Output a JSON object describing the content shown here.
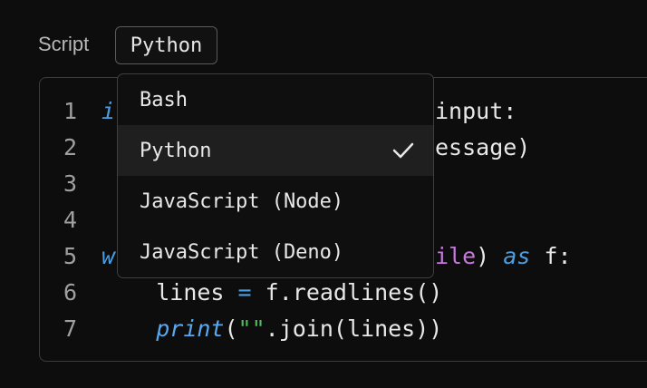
{
  "script_label": "Script",
  "language_select": {
    "value": "Python"
  },
  "dropdown": {
    "options": [
      {
        "label": "Bash",
        "selected": false
      },
      {
        "label": "Python",
        "selected": true
      },
      {
        "label": "JavaScript (Node)",
        "selected": false
      },
      {
        "label": "JavaScript (Deno)",
        "selected": false
      }
    ],
    "check_icon": "checkmark-icon"
  },
  "editor": {
    "line_numbers": [
      "1",
      "2",
      "3",
      "4",
      "5",
      "6",
      "7"
    ],
    "lines": {
      "l1": {
        "kw": "i",
        "tail": "input:"
      },
      "l2": {
        "tail": "essage)"
      },
      "l5": {
        "kw": "w",
        "pu": "ile",
        "paren": ")",
        "as": "as",
        "tail": " f:"
      },
      "l6": {
        "indent": "    ",
        "var": "lines",
        "op": "=",
        "tail": " f.readlines()"
      },
      "l7": {
        "indent": "    ",
        "fn": "print",
        "open": "(",
        "str": "\"\"",
        "tail": ".join(lines))"
      }
    }
  },
  "colors": {
    "keyword": "#4d9de0",
    "string": "#4cbf5c",
    "purple": "#c678dd",
    "background": "#0d0d0d"
  }
}
